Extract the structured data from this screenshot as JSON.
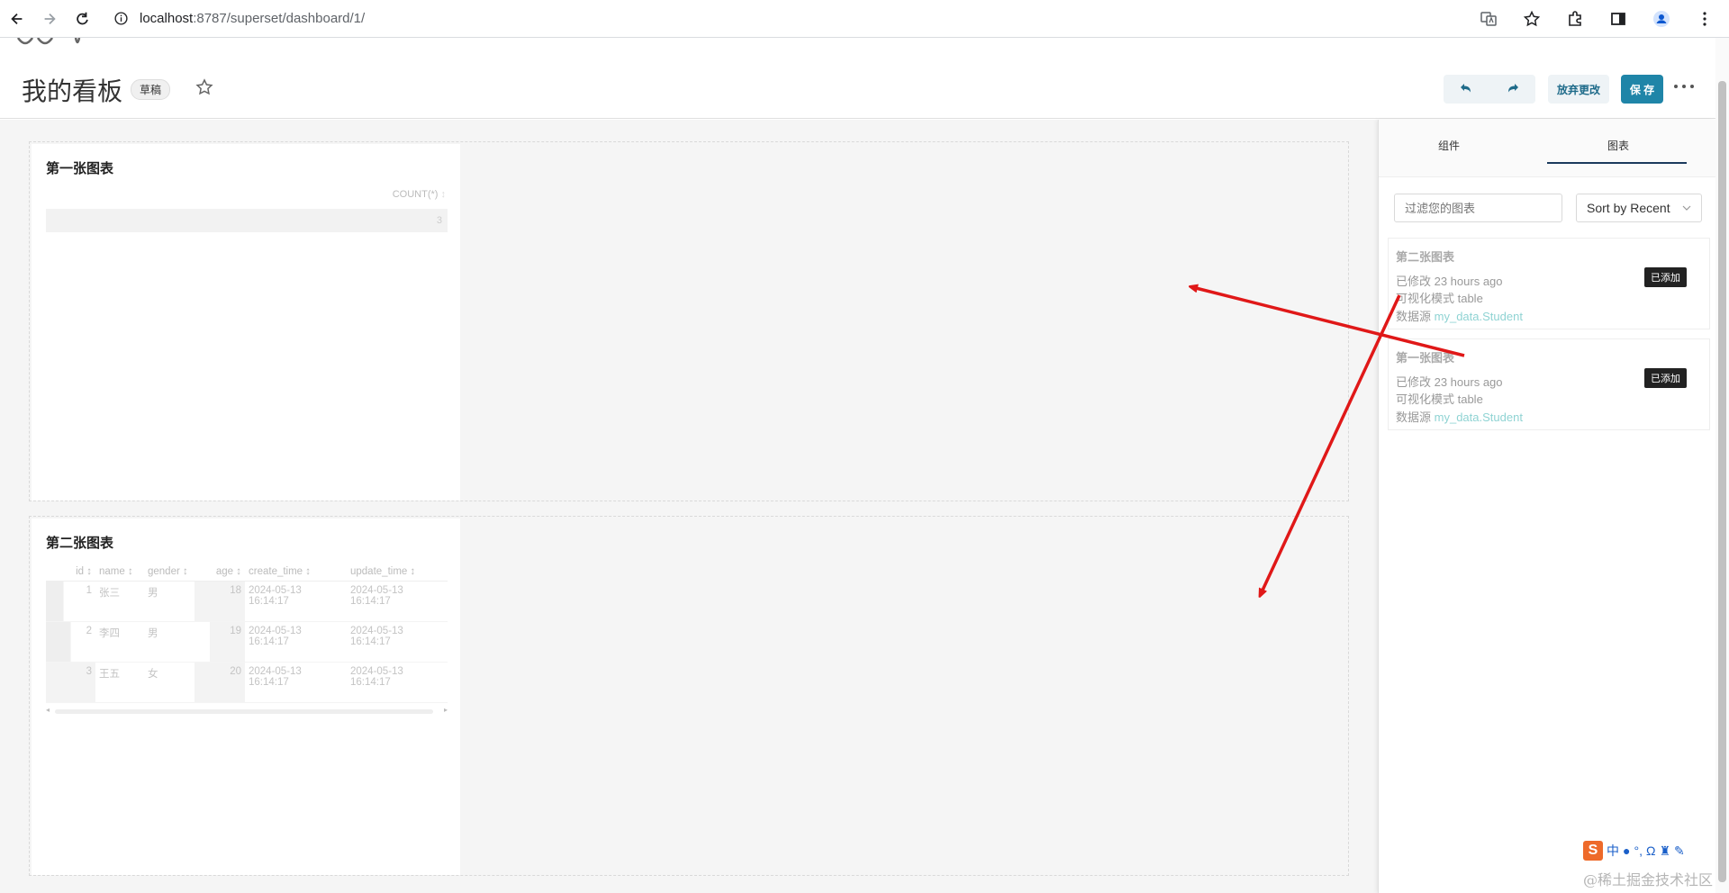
{
  "browser": {
    "url_host": "localhost",
    "url_path": ":8787/superset/dashboard/1/"
  },
  "header": {
    "title": "我的看板",
    "draft_badge": "草稿",
    "discard_label": "放弃更改",
    "save_label": "保 存"
  },
  "charts": {
    "chart1": {
      "title": "第一张图表",
      "column": "COUNT(*)",
      "value": "3"
    },
    "chart2": {
      "title": "第二张图表",
      "columns": [
        "id",
        "name",
        "gender",
        "age",
        "create_time",
        "update_time"
      ],
      "rows": [
        {
          "id": "1",
          "name": "张三",
          "gender": "男",
          "age": "18",
          "create_time": "2024-05-13 16:14:17",
          "update_time": "2024-05-13 16:14:17"
        },
        {
          "id": "2",
          "name": "李四",
          "gender": "男",
          "age": "19",
          "create_time": "2024-05-13 16:14:17",
          "update_time": "2024-05-13 16:14:17"
        },
        {
          "id": "3",
          "name": "王五",
          "gender": "女",
          "age": "20",
          "create_time": "2024-05-13 16:14:17",
          "update_time": "2024-05-13 16:14:17"
        }
      ]
    }
  },
  "side_panel": {
    "tabs": [
      "组件",
      "图表"
    ],
    "active_tab": "图表",
    "filter_placeholder": "过滤您的图表",
    "sort_value": "Sort by Recent",
    "cards": [
      {
        "title": "第二张图表",
        "modified": "已修改 23 hours ago",
        "viz": "可视化模式 table",
        "source_label": "数据源",
        "source": "my_data.Student",
        "badge": "已添加"
      },
      {
        "title": "第一张图表",
        "modified": "已修改 23 hours ago",
        "viz": "可视化模式 table",
        "source_label": "数据源",
        "source": "my_data.Student",
        "badge": "已添加"
      }
    ]
  },
  "ime": {
    "logo": "S",
    "mode": "中"
  },
  "watermark": "@稀土掘金技术社区",
  "colors": {
    "accent": "#1f85a8",
    "arrow": "#e01818"
  }
}
